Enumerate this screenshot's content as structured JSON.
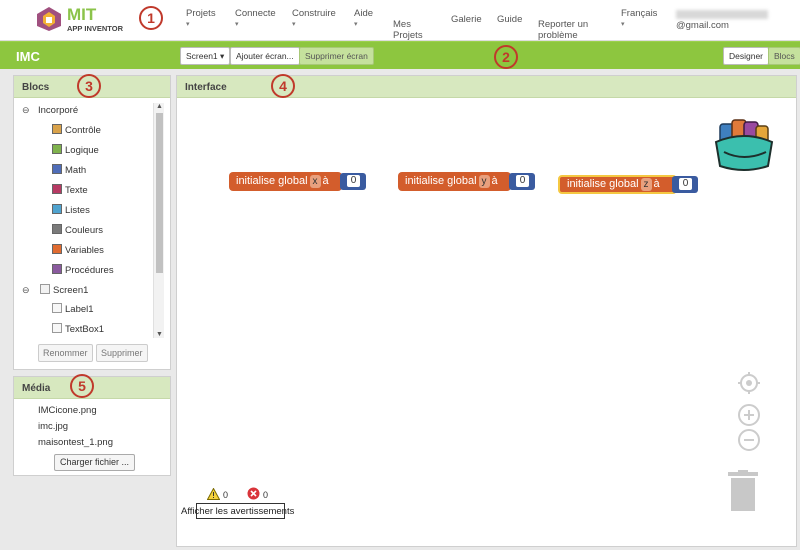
{
  "app": {
    "logo_title": "MIT",
    "logo_subtitle": "APP INVENTOR"
  },
  "nav": {
    "items": [
      {
        "label": "Projets",
        "caret": "▾"
      },
      {
        "label": "Connecte",
        "caret": "▾"
      },
      {
        "label": "Construire",
        "caret": "▾"
      },
      {
        "label": "Aide",
        "caret": "▾"
      },
      {
        "label": "Mes\nProjets"
      },
      {
        "label": "Galerie"
      },
      {
        "label": "Guide"
      },
      {
        "label": "Reporter un\nproblème"
      },
      {
        "label": "Français",
        "caret": "▾"
      }
    ],
    "email_suffix": "@gmail.com"
  },
  "toolbar": {
    "project_name": "IMC",
    "screen_select": "Screen1 ▾",
    "add_screen": "Ajouter écran...",
    "remove_screen": "Supprimer écran",
    "designer": "Designer",
    "blocks": "Blocs"
  },
  "callouts": [
    "1",
    "2",
    "3",
    "4",
    "5"
  ],
  "blocks_panel": {
    "title": "Blocs",
    "builtin_label": "Incorporé",
    "builtin": [
      {
        "label": "Contrôle",
        "color": "#d9a24a"
      },
      {
        "label": "Logique",
        "color": "#7fb24d"
      },
      {
        "label": "Math",
        "color": "#4f6db8"
      },
      {
        "label": "Texte",
        "color": "#b73a63"
      },
      {
        "label": "Listes",
        "color": "#4fa3cf"
      },
      {
        "label": "Couleurs",
        "color": "#7a7a7a"
      },
      {
        "label": "Variables",
        "color": "#e06b30"
      },
      {
        "label": "Procédures",
        "color": "#8a5a9e"
      }
    ],
    "screen_label": "Screen1",
    "components": [
      "Label1",
      "TextBox1"
    ],
    "rename": "Renommer",
    "delete": "Supprimer"
  },
  "media_panel": {
    "title": "Média",
    "files": [
      "IMCicone.png",
      "imc.jpg",
      "maisontest_1.png"
    ],
    "upload": "Charger fichier ..."
  },
  "workspace": {
    "title": "Interface",
    "blocks": [
      {
        "prefix": "initialise global",
        "var": "x",
        "suffix": "à",
        "value": "0"
      },
      {
        "prefix": "initialise global",
        "var": "y",
        "suffix": "à",
        "value": "0"
      },
      {
        "prefix": "initialise global",
        "var": "z",
        "suffix": "à",
        "value": "0"
      }
    ],
    "warnings_count": "0",
    "errors_count": "0",
    "show_warnings": "Afficher les avertissements"
  }
}
